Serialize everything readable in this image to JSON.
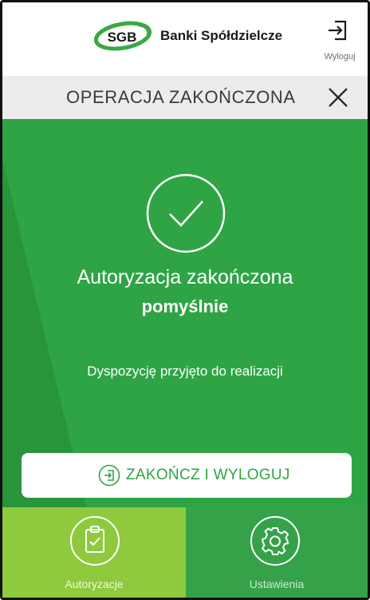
{
  "header": {
    "logo_text": "SGB",
    "bank_name": "Banki Spółdzielcze",
    "logout_label": "Wyloguj",
    "logout_icon": "logout-icon"
  },
  "titlebar": {
    "title": "OPERACJA ZAKOŃCZONA",
    "close_icon": "close-icon"
  },
  "content": {
    "status_icon": "checkmark-circle-icon",
    "message_line1": "Autoryzacja zakończona",
    "message_line2": "pomyślnie",
    "info": "Dyspozycję przyjęto do realizacji",
    "finish_button_label": "ZAKOŃCZ I WYLOGUJ",
    "finish_button_icon": "logout-icon"
  },
  "bottom_nav": {
    "items": [
      {
        "label": "Autoryzacje",
        "icon": "clipboard-check-icon",
        "active": true
      },
      {
        "label": "Ustawienia",
        "icon": "gear-icon",
        "active": false
      }
    ]
  },
  "colors": {
    "brand_green": "#2fa445",
    "active_tab_green": "#8ec93e",
    "settings_tab_green": "#35a24a",
    "titlebar_bg": "#ececec"
  }
}
